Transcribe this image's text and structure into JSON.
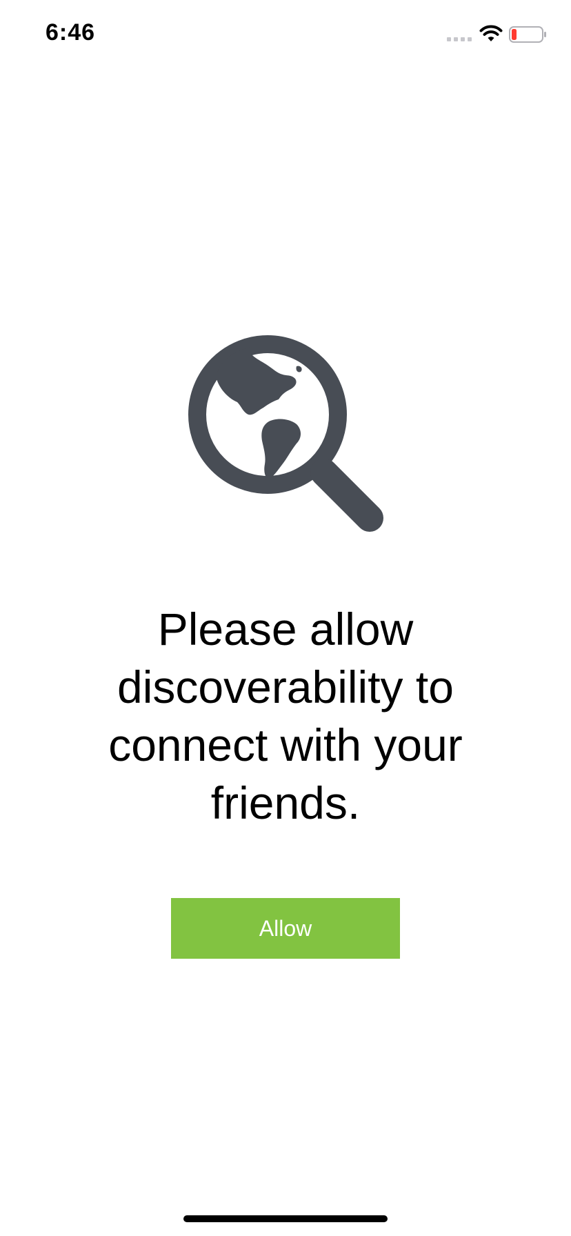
{
  "status_bar": {
    "time": "6:46",
    "signal_icon": "cellular-signal-icon",
    "wifi_icon": "wifi-icon",
    "battery_icon": "battery-low-icon",
    "battery_color": "#ff3b30"
  },
  "hero": {
    "icon": "globe-magnifier-icon",
    "icon_color": "#484d55"
  },
  "message": "Please allow discoverability to connect with your friends.",
  "allow_button": {
    "label": "Allow",
    "color": "#82c341"
  }
}
